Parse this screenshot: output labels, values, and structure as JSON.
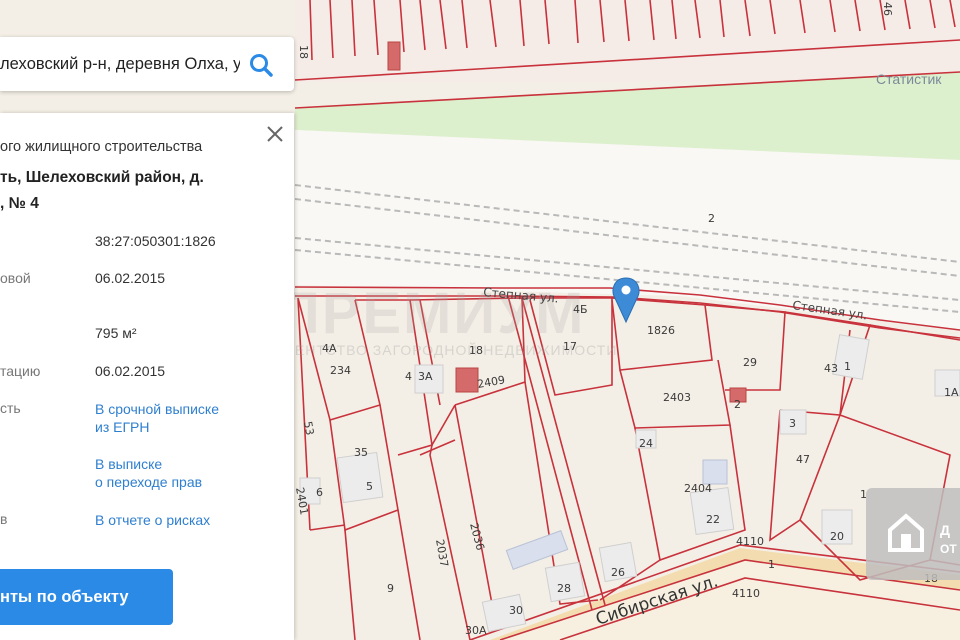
{
  "search": {
    "value": "лехoвский р-н, деревня Олха, у"
  },
  "header": {
    "stats_link": "Статистик"
  },
  "panel": {
    "type_text": "ого жилищного строительства",
    "address_line1": "ть, Шелеховский район, д.",
    "address_line2": ", № 4",
    "rows": [
      {
        "label": "",
        "value": "38:27:050301:1826"
      },
      {
        "label": "овой",
        "value": "06.02.2015"
      },
      {
        "label": "",
        "value": "795 м²"
      },
      {
        "label": "тацию",
        "value": "06.02.2015"
      }
    ],
    "links": [
      {
        "label": "сть",
        "line1": "В срочной выписке",
        "line2": "из ЕГРН"
      },
      {
        "label": "",
        "line1": "В выписке",
        "line2": "о переходе прав"
      },
      {
        "label": "в",
        "line1": "В отчете о рисках",
        "line2": ""
      }
    ],
    "docs_button": "нты по объекту"
  },
  "watermark": {
    "big": "ПРЕМИУМ",
    "small": "АГЕНТСТВО ЗАГОРОДНОЙ НЕДВИЖИМОСТИ"
  },
  "badge": {
    "line1": "Д",
    "line2": "ОТ"
  },
  "map": {
    "streets": [
      "Степная ул.",
      "Степная ул.",
      "Сибирская ул."
    ],
    "parcel_labels": [
      "18",
      "46",
      "2",
      "4Б",
      "1826",
      "17",
      "18",
      "2409",
      "4",
      "3А",
      "4А",
      "234",
      "29",
      "43",
      "1",
      "1А",
      "2403",
      "2",
      "24",
      "3",
      "47",
      "2404",
      "22",
      "35",
      "5",
      "6",
      "53",
      "2401",
      "2037",
      "2036",
      "9",
      "28",
      "26",
      "30",
      "30А",
      "4110",
      "1",
      "4110",
      "20",
      "18",
      "1"
    ]
  },
  "colors": {
    "parcel_line": "#c8323c",
    "road": "#f7f7f5",
    "green": "#ddf0cd",
    "accent": "#2b8ae6"
  }
}
